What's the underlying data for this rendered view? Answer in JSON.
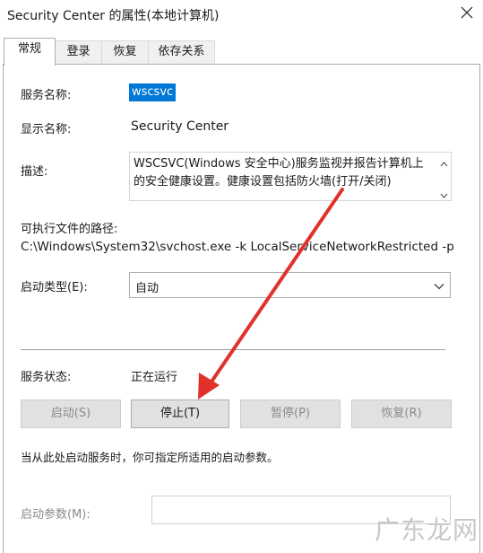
{
  "window": {
    "title": "Security Center 的属性(本地计算机)",
    "close_icon": "close-icon"
  },
  "tabs": [
    {
      "label": "常规",
      "active": true
    },
    {
      "label": "登录",
      "active": false
    },
    {
      "label": "恢复",
      "active": false
    },
    {
      "label": "依存关系",
      "active": false
    }
  ],
  "general": {
    "service_name_label": "服务名称:",
    "service_name_value": "wscsvc",
    "display_name_label": "显示名称:",
    "display_name_value": "Security Center",
    "description_label": "描述:",
    "description_value": "WSCSVC(Windows 安全中心)服务监视并报告计算机上的安全健康设置。健康设置包括防火墙(打开/关闭)",
    "exe_path_label": "可执行文件的路径:",
    "exe_path_value": "C:\\Windows\\System32\\svchost.exe -k LocalServiceNetworkRestricted -p",
    "startup_type_label": "启动类型(E):",
    "startup_type_value": "自动",
    "status_label": "服务状态:",
    "status_value": "正在运行",
    "buttons": {
      "start": "启动(S)",
      "stop": "停止(T)",
      "pause": "暂停(P)",
      "resume": "恢复(R)"
    },
    "hint": "当从此处启动服务时，你可指定所适用的启动参数。",
    "start_params_label": "启动参数(M):",
    "start_params_value": ""
  },
  "overlay": {
    "watermark": "广东龙网",
    "annotation_color": "#e0322b"
  },
  "colors": {
    "selection": "#0078d7",
    "button_face": "#e1e1e1",
    "disabled_text": "#8a8a8a"
  }
}
